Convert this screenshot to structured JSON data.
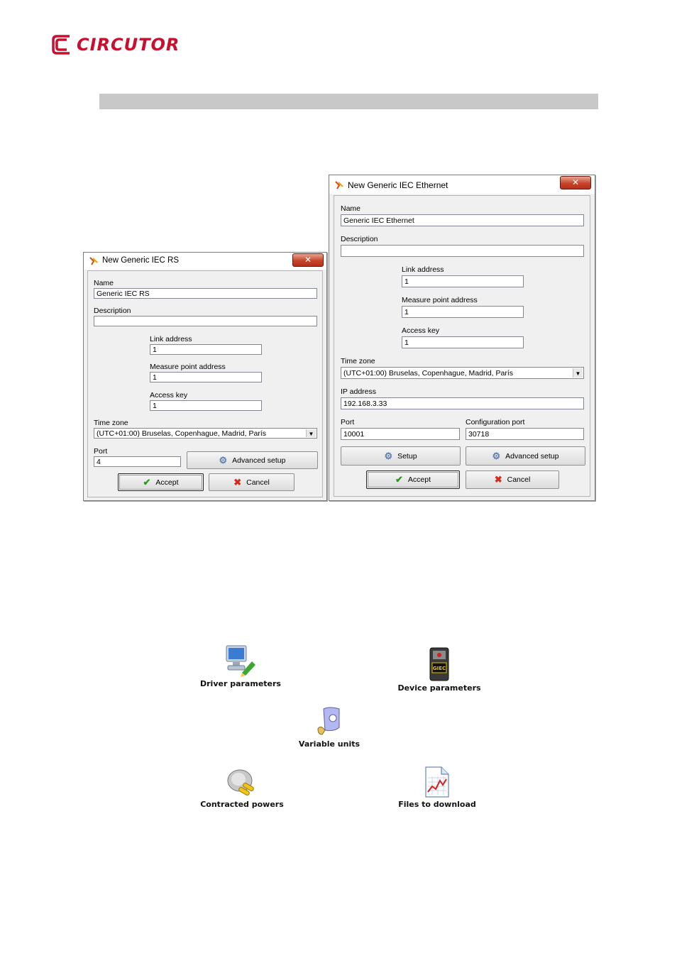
{
  "logo": {
    "text": "CIRCUTOR",
    "brand_color": "#c8102e"
  },
  "dialog_rs": {
    "title": "New Generic IEC RS",
    "close_symbol": "✕",
    "name_label": "Name",
    "name_value": "Generic IEC RS",
    "description_label": "Description",
    "description_value": "",
    "link_address_label": "Link address",
    "link_address_value": "1",
    "measure_point_label": "Measure point address",
    "measure_point_value": "1",
    "access_key_label": "Access key",
    "access_key_value": "1",
    "time_zone_label": "Time zone",
    "time_zone_value": "(UTC+01:00) Bruselas, Copenhague, Madrid, París",
    "port_label": "Port",
    "port_value": "4",
    "advanced_setup_label": "Advanced setup",
    "accept_label": "Accept",
    "cancel_label": "Cancel"
  },
  "dialog_eth": {
    "title": "New Generic IEC Ethernet",
    "close_symbol": "✕",
    "name_label": "Name",
    "name_value": "Generic IEC Ethernet",
    "description_label": "Description",
    "description_value": "",
    "link_address_label": "Link address",
    "link_address_value": "1",
    "measure_point_label": "Measure point address",
    "measure_point_value": "1",
    "access_key_label": "Access key",
    "access_key_value": "1",
    "time_zone_label": "Time zone",
    "time_zone_value": "(UTC+01:00) Bruselas, Copenhague, Madrid, París",
    "ip_label": "IP address",
    "ip_value": "192.168.3.33",
    "port_label": "Port",
    "port_value": "10001",
    "config_port_label": "Configuration port",
    "config_port_value": "30718",
    "setup_label": "Setup",
    "advanced_setup_label": "Advanced setup",
    "accept_label": "Accept",
    "cancel_label": "Cancel"
  },
  "icons": {
    "driver_parameters": "Driver parameters",
    "device_parameters": "Device parameters",
    "device_badge": "GIEC",
    "variable_units": "Variable units",
    "contracted_powers": "Contracted powers",
    "files_to_download": "Files to download"
  }
}
